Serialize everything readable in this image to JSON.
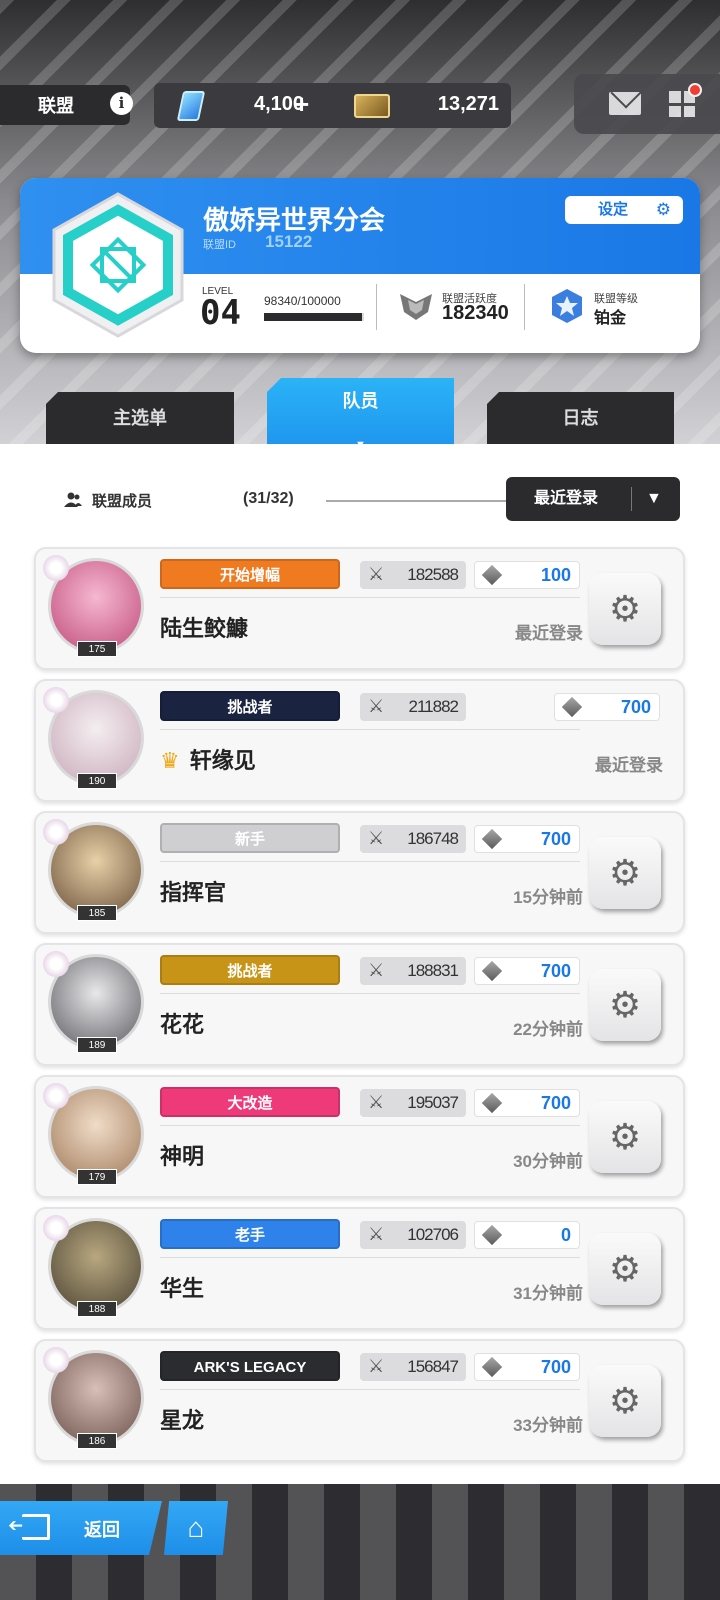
{
  "hud": {
    "union_tag": "联盟",
    "info_icon": "info-icon",
    "gems": "4,100",
    "gems_plus": "+",
    "tickets": "13,271"
  },
  "union": {
    "name": "傲娇异世界分会",
    "id_label": "联盟ID",
    "id": "15122",
    "settings_label": "设定",
    "level_label": "LEVEL",
    "level": "04",
    "exp_text": "98340/100000",
    "exp_fraction": 0.9834,
    "activity_label": "联盟活跃度",
    "activity": "182340",
    "rank_label": "联盟等级",
    "rank": "铂金"
  },
  "tabs": {
    "main": "主选单",
    "members": "队员",
    "log": "日志"
  },
  "member_list": {
    "label": "联盟成员",
    "count": "(31/32)",
    "sort_label": "最近登录",
    "sort_arrow": "▼"
  },
  "members": [
    {
      "name": "陆生鲛鱇",
      "level": "175",
      "title": "开始增幅",
      "power": "182588",
      "contrib": "100",
      "login": "最近登录",
      "leader": false,
      "colors": {
        "badge": "#f07a20",
        "c1": "#f5b8d0",
        "c2": "#c04a7a"
      }
    },
    {
      "name": "轩缘见",
      "level": "190",
      "title": "挑战者",
      "power": "211882",
      "contrib": "700",
      "login": "最近登录",
      "leader": true,
      "colors": {
        "badge": "#1a2340",
        "c1": "#f4eef0",
        "c2": "#c8a8b8"
      }
    },
    {
      "name": "指挥官",
      "level": "185",
      "title": "新手",
      "power": "186748",
      "contrib": "700",
      "login": "15分钟前",
      "leader": false,
      "colors": {
        "badge": "#cfcfd2",
        "c1": "#e8d0a8",
        "c2": "#6a5038"
      }
    },
    {
      "name": "花花",
      "level": "189",
      "title": "挑战者",
      "power": "188831",
      "contrib": "700",
      "login": "22分钟前",
      "leader": false,
      "colors": {
        "badge": "#c89418",
        "c1": "#e8e8ea",
        "c2": "#5a5a60"
      }
    },
    {
      "name": "神明",
      "level": "179",
      "title": "大改造",
      "power": "195037",
      "contrib": "700",
      "login": "30分钟前",
      "leader": false,
      "colors": {
        "badge": "#ee3a78",
        "c1": "#f0dcc8",
        "c2": "#a07a5a"
      }
    },
    {
      "name": "华生",
      "level": "188",
      "title": "老手",
      "power": "102706",
      "contrib": "0",
      "login": "31分钟前",
      "leader": false,
      "colors": {
        "badge": "#2f82ea",
        "c1": "#b8a880",
        "c2": "#4a4232"
      }
    },
    {
      "name": "星龙",
      "level": "186",
      "title": "ARK'S LEGACY",
      "power": "156847",
      "contrib": "700",
      "login": "33分钟前",
      "leader": false,
      "colors": {
        "badge": "#2a2c30",
        "c1": "#d8c0b8",
        "c2": "#6a5048"
      }
    }
  ],
  "bottom": {
    "back_label": "返回",
    "home_icon": "home-icon"
  }
}
